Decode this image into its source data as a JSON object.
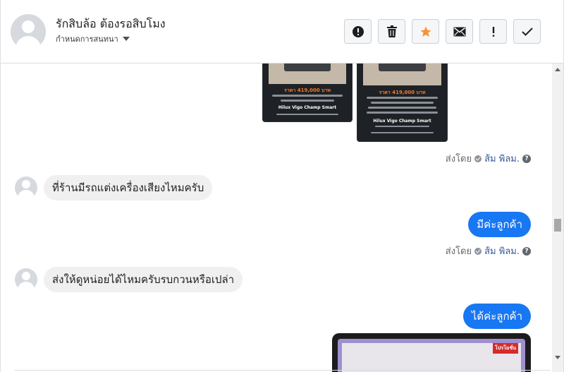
{
  "header": {
    "contact_name": "รักสิบล้อ ต้องรอสิบโมง",
    "status_label": "กำหนดการสนทนา",
    "actions": [
      {
        "name": "spam-button",
        "icon": "alert-circle-icon"
      },
      {
        "name": "delete-button",
        "icon": "trash-icon"
      },
      {
        "name": "star-button",
        "icon": "star-icon",
        "color": "#f7923b"
      },
      {
        "name": "mark-unread-button",
        "icon": "envelope-icon"
      },
      {
        "name": "important-button",
        "icon": "exclamation-icon"
      },
      {
        "name": "done-button",
        "icon": "check-icon"
      }
    ]
  },
  "messages": {
    "card_left": {
      "price": "ราคา 419,000 บาท",
      "model": "Hilux Vigo Champ Smart"
    },
    "card_right": {
      "price": "ราคา 419,000 บาท",
      "model": "Hilux Vigo Champ Smart"
    },
    "sent_by_prefix": "ส่งโดย",
    "sent_by_name": "ส้ม พิลม.",
    "incoming_1": "ที่ร้านมีรถแต่งเครื่องเสียงไหมครับ",
    "outgoing_1": "มีค่ะลูกค้า",
    "incoming_2": "ส่งให้ดูหน่อยได้ไหมครับรบกวนหรือเปล่า",
    "outgoing_2": "ได้ค่ะลูกค้า",
    "big_card_tag": "โปรโมชั่น"
  },
  "colors": {
    "accent": "#1877f2",
    "incoming_bubble": "#f0f0f0"
  }
}
